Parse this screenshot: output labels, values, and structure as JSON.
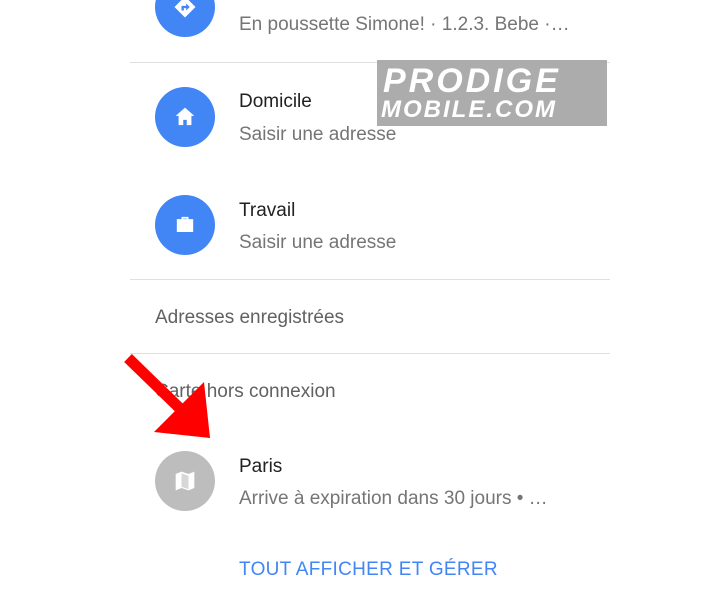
{
  "recent": {
    "subtitle": "En poussette Simone! · 1.2.3. Bebe ·…"
  },
  "home": {
    "title": "Domicile",
    "subtitle": "Saisir une adresse"
  },
  "work": {
    "title": "Travail",
    "subtitle": "Saisir une adresse"
  },
  "saved_addresses": {
    "label": "Adresses enregistrées"
  },
  "offline_maps": {
    "label": "Carte hors connexion",
    "item_title": "Paris",
    "item_subtitle": "Arrive à expiration dans 30 jours  • …"
  },
  "manage_link": "TOUT AFFICHER ET GÉRER",
  "watermark": {
    "line1": "PRODIGE",
    "line2": "MOBILE.COM"
  },
  "colors": {
    "accent": "#4285f4",
    "annotation_arrow": "#ff0000"
  }
}
